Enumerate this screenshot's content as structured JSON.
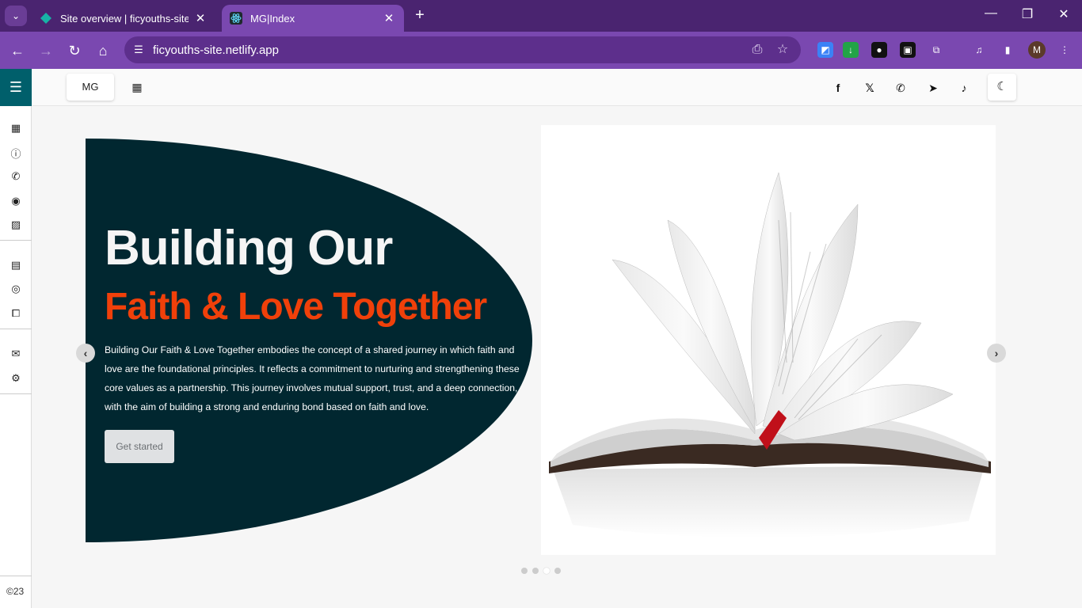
{
  "browser": {
    "tabs": [
      {
        "title": "Site overview | ficyouths-site | N",
        "favicon": "netlify-diamond-icon",
        "active": false
      },
      {
        "title": "MG|Index",
        "favicon": "react-atom-icon",
        "active": true
      }
    ],
    "url": "ficyouths-site.netlify.app",
    "profile_initial": "M"
  },
  "site": {
    "brand": "MG",
    "copyright": "©23",
    "sidebar_icons": [
      "dashboard-icon",
      "info-icon",
      "phone-icon",
      "user-circle-icon",
      "image-icon",
      "blog-icon",
      "podcast-icon",
      "external-link-icon",
      "mail-icon",
      "settings-icon"
    ],
    "social_icons": [
      "facebook-icon",
      "x-twitter-icon",
      "whatsapp-icon",
      "telegram-icon",
      "tiktok-icon"
    ]
  },
  "hero": {
    "heading_line1": "Building Our",
    "heading_line2": "Faith & Love Together",
    "description": "Building Our Faith & Love Together embodies the concept of a shared journey in which faith and love are the foundational principles. It reflects a commitment to nurturing and strengthening these core values as a partnership. This journey involves mutual support, trust, and a deep connection, with the aim of building a strong and enduring bond based on faith and love.",
    "cta_label": "Get started"
  },
  "carousel": {
    "slide_count": 4,
    "active_index": 2
  },
  "colors": {
    "browser_frame": "#4a2470",
    "browser_toolbar": "#7a48b0",
    "sidebar_accent": "#005f6b",
    "hero_bg": "#012730",
    "hero_accent": "#f0400a"
  }
}
